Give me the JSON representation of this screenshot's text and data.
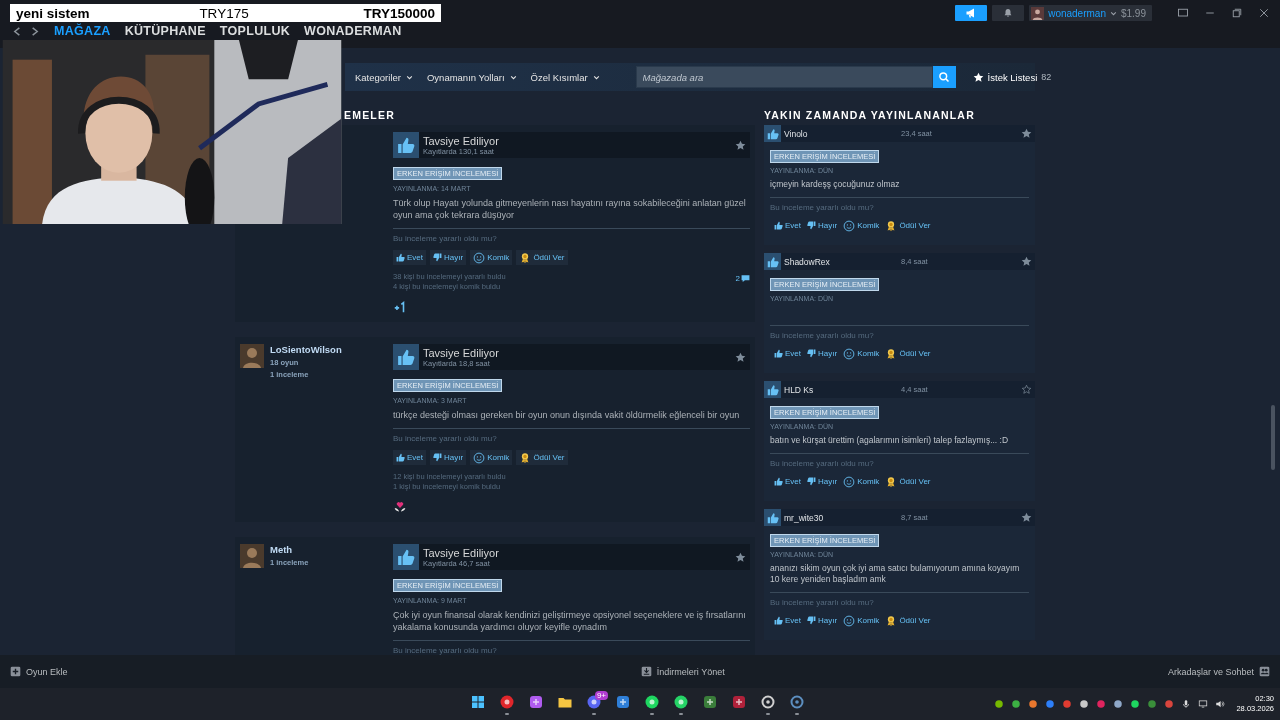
{
  "overlay": {
    "title": "yeni sistem",
    "value_1": "TRY175",
    "value_2": "TRY150000"
  },
  "titlebar": {
    "nav": [
      {
        "label": "MAĞAZA",
        "selected": true
      },
      {
        "label": "KÜTÜPHANE",
        "selected": false
      },
      {
        "label": "TOPLULUK",
        "selected": false
      },
      {
        "label": "WONADERMAN",
        "selected": false
      }
    ],
    "account": {
      "name": "wonaderman",
      "balance": "$1.99"
    }
  },
  "store_nav": {
    "menus": [
      "Kategoriler",
      "Oynamanın Yolları",
      "Özel Kısımlar"
    ],
    "search": {
      "placeholder": "Mağazada ara"
    },
    "wishlist": {
      "label": "İstek Listesi",
      "count": "82"
    }
  },
  "reviews": {
    "heading": "EMELER",
    "items": [
      {
        "verdict": "Tavsiye Ediliyor",
        "hours": "Kayıtlarda 130,1 saat",
        "starred": true,
        "badge": "ERKEN ERİŞİM İNCELEMESİ",
        "date": "YAYINLANMA: 14 MART",
        "text": "Türk olup Hayatı yolunda gitmeyenlerin nası hayatını rayına sokabileceğini anlatan güzel oyun ama çok tekrara düşüyor",
        "question": "Bu inceleme yararlı oldu mu?",
        "buttons": [
          {
            "kind": "yes",
            "label": "Evet"
          },
          {
            "kind": "no",
            "label": "Hayır"
          },
          {
            "kind": "funny",
            "label": "Komik"
          },
          {
            "kind": "award",
            "label": "Ödül Ver"
          }
        ],
        "counts": [
          "38 kişi bu incelemeyi yararlı buldu",
          "4 kişi bu incelemeyi komik buldu"
        ],
        "comments": "2",
        "award": {
          "kind": "plus"
        }
      },
      {
        "author": {
          "name": "LoSientoWilson",
          "games": "18 oyun",
          "reviews": "1 inceleme"
        },
        "verdict": "Tavsiye Ediliyor",
        "hours": "Kayıtlarda 18,8 saat",
        "starred": true,
        "badge": "ERKEN ERİŞİM İNCELEMESİ",
        "date": "YAYINLANMA: 3 MART",
        "text": "türkçe desteği olması gereken bir oyun onun dışında vakit öldürmelik eğlenceli bir oyun",
        "question": "Bu inceleme yararlı oldu mu?",
        "buttons": [
          {
            "kind": "yes",
            "label": "Evet"
          },
          {
            "kind": "no",
            "label": "Hayır"
          },
          {
            "kind": "funny",
            "label": "Komik"
          },
          {
            "kind": "award",
            "label": "Ödül Ver"
          }
        ],
        "counts": [
          "12 kişi bu incelemeyi yararlı buldu",
          "1 kişi bu incelemeyi komik buldu"
        ],
        "award": {
          "kind": "heart"
        }
      },
      {
        "author": {
          "name": "Meth",
          "reviews": "1 inceleme"
        },
        "verdict": "Tavsiye Ediliyor",
        "hours": "Kayıtlarda 46,7 saat",
        "starred": true,
        "badge": "ERKEN ERİŞİM İNCELEMESİ",
        "date": "YAYINLANMA: 9 MART",
        "text": "Çok iyi oyun finansal olarak kendinizi geliştirmeye opsiyonel seçeneklere ve iş fırsatlarını yakalama konusunda yardımcı oluyor keyifle oynadım",
        "question": "Bu inceleme yararlı oldu mu?"
      }
    ]
  },
  "recent": {
    "heading": "YAKIN ZAMANDA YAYINLANANLAR",
    "items": [
      {
        "name": "Vinolo",
        "hours": "23,4 saat",
        "starred": true,
        "badge": "ERKEN ERİŞİM İNCELEMESİ",
        "date": "YAYINLANMA: DÜN",
        "text": "içmeyin kardeşş çocuğunuz olmaz",
        "question": "Bu inceleme yararlı oldu mu?",
        "buttons": [
          {
            "kind": "yes",
            "label": "Evet"
          },
          {
            "kind": "no",
            "label": "Hayır"
          },
          {
            "kind": "funny",
            "label": "Komik"
          },
          {
            "kind": "award",
            "label": "Ödül Ver"
          }
        ]
      },
      {
        "name": "ShadowRex",
        "hours": "8,4 saat",
        "starred": true,
        "badge": "ERKEN ERİŞİM İNCELEMESİ",
        "date": "YAYINLANMA: DÜN",
        "question": "Bu inceleme yararlı oldu mu?",
        "buttons": [
          {
            "kind": "yes",
            "label": "Evet"
          },
          {
            "kind": "no",
            "label": "Hayır"
          },
          {
            "kind": "funny",
            "label": "Komik"
          },
          {
            "kind": "award",
            "label": "Ödül Ver"
          }
        ]
      },
      {
        "name": "HLD Ks",
        "hours": "4,4 saat",
        "starred": false,
        "badge": "ERKEN ERİŞİM İNCELEMESİ",
        "date": "YAYINLANMA: DÜN",
        "text": "batın ve kürşat ürettim (agalarımın isimleri) talep fazlaymış... :D",
        "question": "Bu inceleme yararlı oldu mu?",
        "buttons": [
          {
            "kind": "yes",
            "label": "Evet"
          },
          {
            "kind": "no",
            "label": "Hayır"
          },
          {
            "kind": "funny",
            "label": "Komik"
          },
          {
            "kind": "award",
            "label": "Ödül Ver"
          }
        ]
      },
      {
        "name": "mr_wite30",
        "hours": "8,7 saat",
        "starred": true,
        "badge": "ERKEN ERİŞİM İNCELEMESİ",
        "date": "YAYINLANMA: DÜN",
        "text": "ananızı sikim oyun çok iyi ama satıcı bulamıyorum amına koyayım 10 kere yeniden başladım amk",
        "question": "Bu inceleme yararlı oldu mu?",
        "buttons": [
          {
            "kind": "yes",
            "label": "Evet"
          },
          {
            "kind": "no",
            "label": "Hayır"
          },
          {
            "kind": "funny",
            "label": "Komik"
          },
          {
            "kind": "award",
            "label": "Ödül Ver"
          }
        ]
      }
    ]
  },
  "bottom_bar": {
    "add_game": "Oyun Ekle",
    "downloads": "İndirmeleri Yönet",
    "friends": "Arkadaşlar ve Sohbet"
  },
  "taskbar": {
    "apps": [
      {
        "kind": "start",
        "color": "#4cc2ff",
        "active": false
      },
      {
        "kind": "circle",
        "color": "#e0262b",
        "active": true
      },
      {
        "kind": "square",
        "color": "#b05cf0",
        "active": false
      },
      {
        "kind": "folder",
        "color": "#f5c542",
        "active": false
      },
      {
        "kind": "circle",
        "color": "#5865f2",
        "active": true,
        "badge": "9+"
      },
      {
        "kind": "square",
        "color": "#2f7fd8",
        "active": false
      },
      {
        "kind": "circle",
        "color": "#1ed760",
        "active": true
      },
      {
        "kind": "circle",
        "color": "#25d366",
        "active": true
      },
      {
        "kind": "square",
        "color": "#3a7d3a",
        "active": false
      },
      {
        "kind": "square",
        "color": "#b0213a",
        "active": false
      },
      {
        "kind": "ring",
        "color": "#d0d0d0",
        "active": true
      },
      {
        "kind": "ring",
        "color": "#5d8fc0",
        "active": true
      }
    ],
    "tray": [
      {
        "color": "#76b900"
      },
      {
        "color": "#3cb043"
      },
      {
        "color": "#e8772e"
      },
      {
        "color": "#2d7ff9"
      },
      {
        "color": "#e03c31"
      },
      {
        "color": "#c8c8c8"
      },
      {
        "color": "#e0245e"
      },
      {
        "color": "#8fa8c8"
      },
      {
        "color": "#1ed760"
      },
      {
        "color": "#3a8f3a"
      },
      {
        "color": "#d9453d"
      }
    ],
    "time": "02:30",
    "date": "28.03.2026"
  }
}
